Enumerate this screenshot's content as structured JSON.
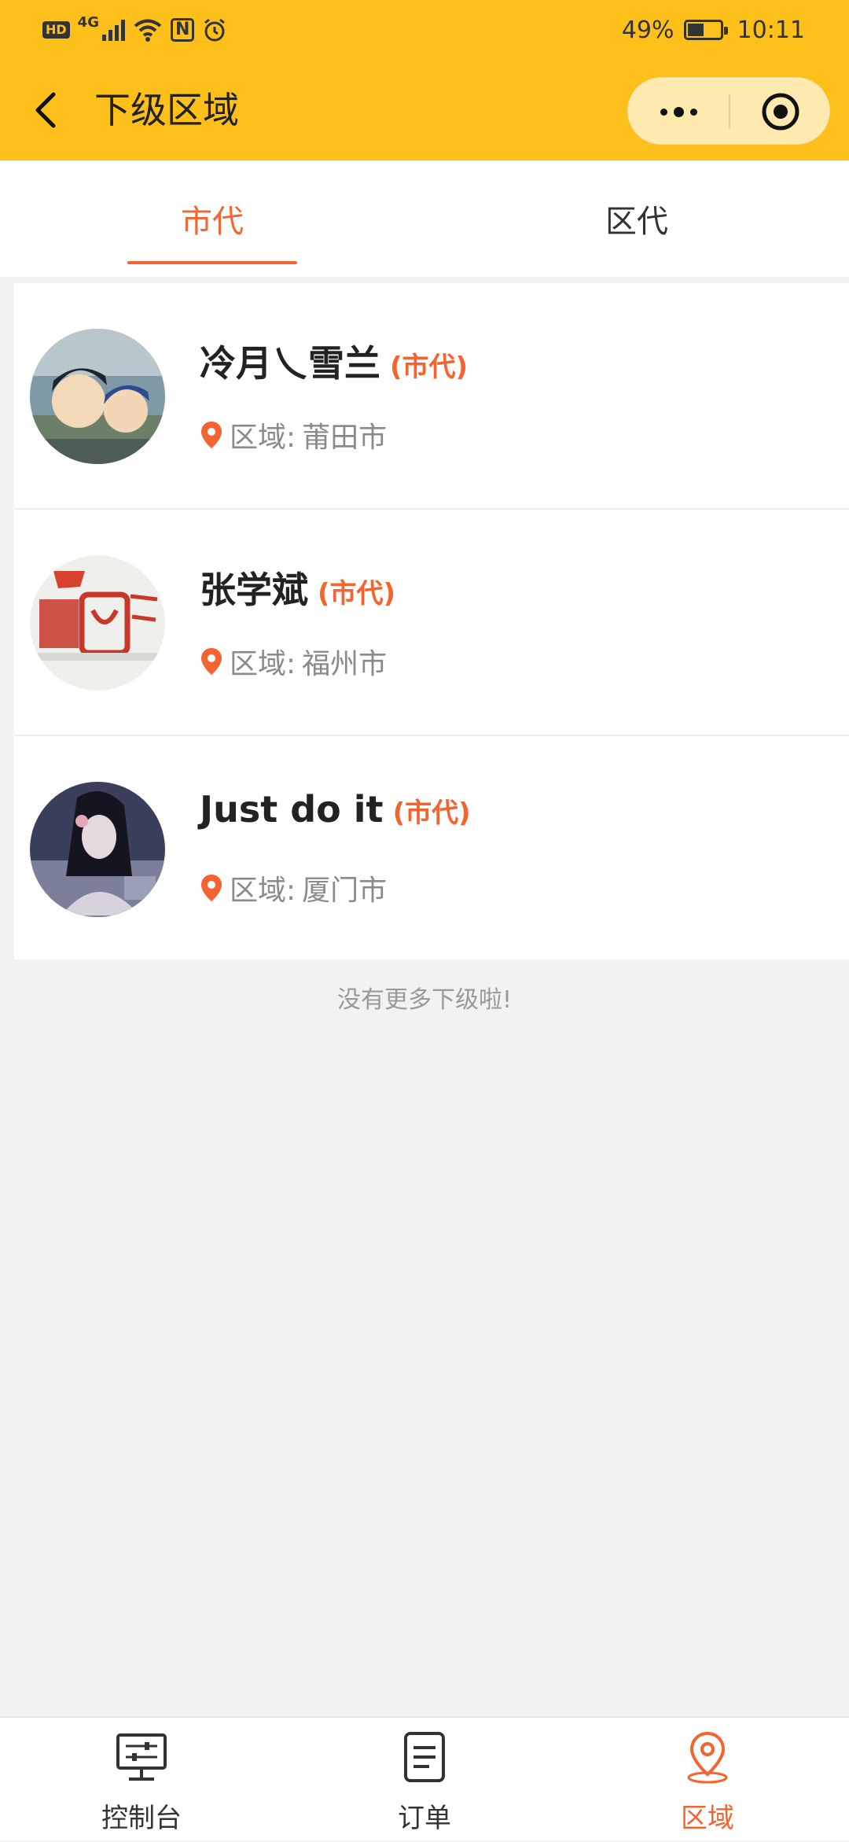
{
  "status_bar": {
    "badge": "HD",
    "network": "4G",
    "nfc": "N",
    "battery_text": "49%",
    "battery_level": 0.49,
    "time": "10:11"
  },
  "nav": {
    "title": "下级区域"
  },
  "tabs": [
    {
      "label": "市代",
      "active": true
    },
    {
      "label": "区代",
      "active": false
    }
  ],
  "agents": [
    {
      "name": "冷月乀雪兰",
      "role": "(市代)",
      "area_label": "区域:",
      "area": "莆田市"
    },
    {
      "name": "张学斌",
      "role": "(市代)",
      "area_label": "区域:",
      "area": "福州市"
    },
    {
      "name": "Just do it",
      "role": "(市代)",
      "area_label": "区域:",
      "area": "厦门市"
    }
  ],
  "footer_note": "没有更多下级啦!",
  "tabbar": [
    {
      "label": "控制台",
      "icon": "dashboard-icon",
      "active": false
    },
    {
      "label": "订单",
      "icon": "order-icon",
      "active": false
    },
    {
      "label": "区域",
      "icon": "location-icon",
      "active": true
    }
  ],
  "colors": {
    "header": "#fdc01b",
    "accent": "#f36430"
  }
}
